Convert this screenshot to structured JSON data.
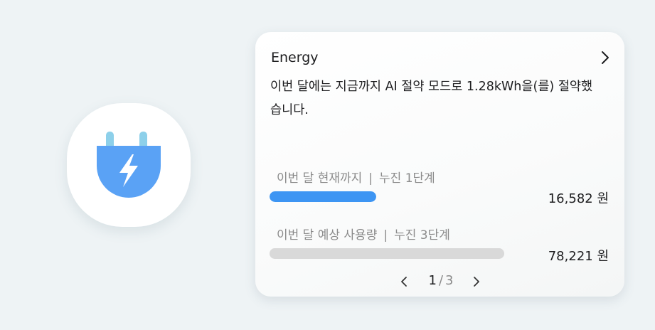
{
  "app_icon": {
    "icon": "plug-lightning-icon",
    "color": "#5aa2f5",
    "prong_color": "#8dd0ea"
  },
  "card": {
    "title": "Energy",
    "message": "이번 달에는 지금까지 AI 절약 모드로 1.28kWh을(를) 절약했습니다.",
    "rows": [
      {
        "label": "이번 달 현재까지",
        "tier": "누진 1단계",
        "amount": "16,582 원",
        "progress": 0.45,
        "fill_color": "#3d95f3"
      },
      {
        "label": "이번 달 예상 사용량",
        "tier": "누진 3단계",
        "amount": "78,221 원",
        "progress": 1.0,
        "fill_color": "#d9d9d9"
      }
    ],
    "pager": {
      "current": "1",
      "total": "3"
    }
  }
}
